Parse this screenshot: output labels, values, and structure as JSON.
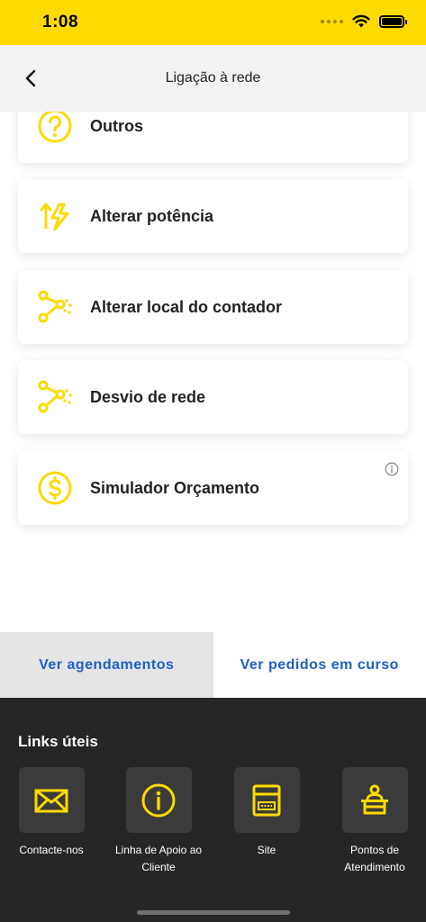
{
  "status_bar": {
    "time": "1:08"
  },
  "nav": {
    "title": "Ligação à rede"
  },
  "services": [
    {
      "label": "Outros",
      "icon": "question-icon"
    },
    {
      "label": "Alterar potência",
      "icon": "power-change-icon"
    },
    {
      "label": "Alterar local do contador",
      "icon": "route-icon"
    },
    {
      "label": "Desvio de rede",
      "icon": "route-icon"
    },
    {
      "label": "Simulador Orçamento",
      "icon": "dollar-coin-icon"
    }
  ],
  "tabs": {
    "schedules": "Ver agendamentos",
    "requests": "Ver pedidos em curso"
  },
  "links": {
    "title": "Links úteis",
    "items": [
      {
        "label": "Contacte-nos",
        "icon": "envelope-icon"
      },
      {
        "label": "Linha de Apoio ao Cliente",
        "icon": "info-circle-icon"
      },
      {
        "label": "Site",
        "icon": "website-icon"
      },
      {
        "label": "Pontos de Atendimento",
        "icon": "service-desk-icon"
      }
    ]
  },
  "colors": {
    "accent": "#FDDA02",
    "link_blue": "#1F5FC4",
    "dark_panel": "#262626"
  }
}
